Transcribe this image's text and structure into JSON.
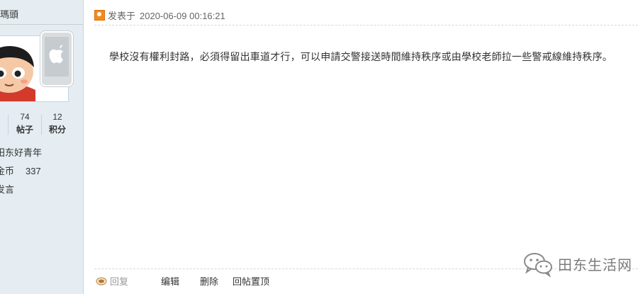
{
  "user": {
    "name": "瑪頭",
    "stats": [
      {
        "value": "",
        "label": ""
      },
      {
        "value": "74",
        "label": "帖子"
      },
      {
        "value": "12",
        "label": "积分"
      }
    ],
    "group": "田东好青年",
    "coin_label": "金币",
    "coin_value": "337",
    "send_message": "发言"
  },
  "post": {
    "posted_label": "发表于",
    "timestamp": "2020-06-09 00:16:21",
    "content": "學校沒有權利封路，必須得留出車道才行，可以申請交警接送時間維持秩序或由學校老師拉一些警戒線維持秩序。"
  },
  "footer": {
    "reply": "回复",
    "edit": "编辑",
    "delete": "删除",
    "pin": "回帖置顶"
  },
  "watermark": {
    "text": "田东生活网"
  },
  "colors": {
    "sidebar_bg": "#e5edf2",
    "border": "#c2d5e3",
    "post_icon": "#f28b1b"
  }
}
